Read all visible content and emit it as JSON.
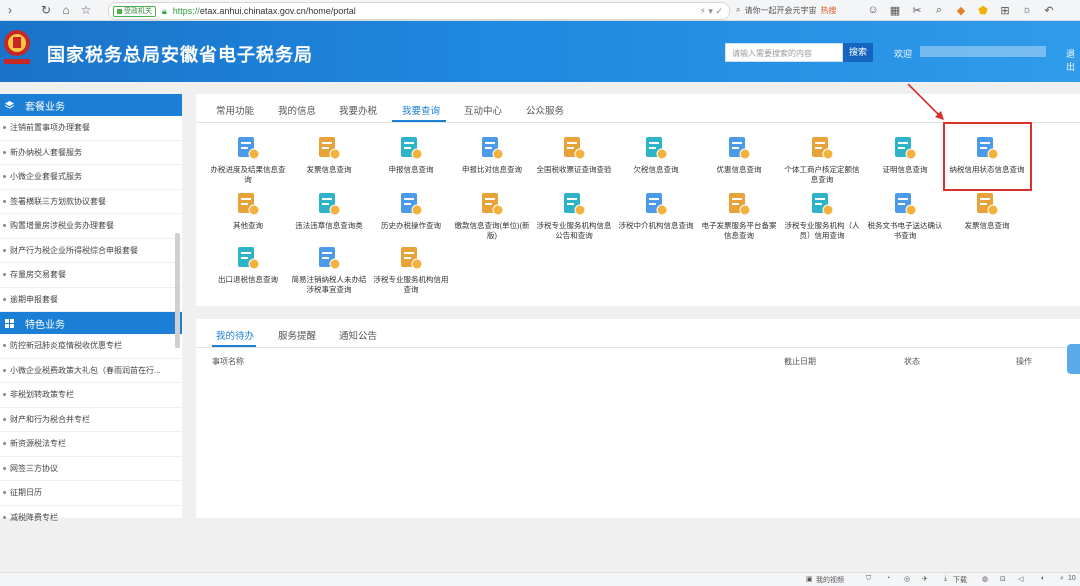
{
  "browser": {
    "security_label": "受政机关",
    "url_scheme": "https://",
    "url_rest": "etax.anhui.chinatax.gov.cn/home/portal",
    "search_placeholder": "请你一起开会元宇宙",
    "hot_label": "热搜"
  },
  "header": {
    "site_title": "国家税务总局安徽省电子税务局",
    "search_placeholder": "请输入需要搜索的内容",
    "search_button": "搜索",
    "welcome": "欢迎",
    "logout": "退出"
  },
  "sidebar": {
    "section1_title": "套餐业务",
    "section1_items": [
      "注销前置事项办理套餐",
      "新办纳税人套餐服务",
      "小微企业套餐式服务",
      "签署横联三方划款协议套餐",
      "购置增量房涉税业务办理套餐",
      "财产行为税企业所得税综合申报套餐",
      "存量房交易套餐",
      "逾期申报套餐"
    ],
    "section2_title": "特色业务",
    "section2_items": [
      "防控新冠肺炎疫情税收优惠专栏",
      "小微企业税费政策大礼包（春雨润苗在行...",
      "非税划转政策专栏",
      "财产和行为税合并专栏",
      "新资源税法专栏",
      "网签三方协议",
      "征期日历",
      "减税降费专栏"
    ]
  },
  "main": {
    "tabs": [
      "常用功能",
      "我的信息",
      "我要办税",
      "我要查询",
      "互动中心",
      "公众服务"
    ],
    "active_tab": "我要查询",
    "services": [
      {
        "label": "办税进度及结果信息查询",
        "icon": "search-doc-icon"
      },
      {
        "label": "发票信息查询",
        "icon": "invoice-icon"
      },
      {
        "label": "申报信息查询",
        "icon": "declare-icon"
      },
      {
        "label": "申报比对信息查询",
        "icon": "compare-icon"
      },
      {
        "label": "全国税收票证查询查验",
        "icon": "ticket-icon"
      },
      {
        "label": "欠税信息查询",
        "icon": "arrears-icon"
      },
      {
        "label": "优惠信息查询",
        "icon": "discount-icon"
      },
      {
        "label": "个体工商户核定定额信息查询",
        "icon": "quota-icon"
      },
      {
        "label": "证明信息查询",
        "icon": "certificate-icon"
      },
      {
        "label": "纳税信用状态信息查询",
        "icon": "credit-icon"
      },
      {
        "label": "其他查询",
        "icon": "other-search-icon"
      },
      {
        "label": "违法违章信息查询类",
        "icon": "warning-icon"
      },
      {
        "label": "历史办税操作查询",
        "icon": "history-icon"
      },
      {
        "label": "缴款信息查询(单位)(新版)",
        "icon": "payment-icon"
      },
      {
        "label": "涉税专业服务机构信息公告和查询",
        "icon": "agency-notice-icon"
      },
      {
        "label": "涉税中介机构信息查询",
        "icon": "intermediary-icon"
      },
      {
        "label": "电子发票服务平台备案信息查询",
        "icon": "e-invoice-icon"
      },
      {
        "label": "涉税专业服务机构（人员）信用查询",
        "icon": "agency-credit-icon"
      },
      {
        "label": "税务文书电子送达确认书查询",
        "icon": "document-delivery-icon"
      },
      {
        "label": "发票信息查询",
        "icon": "invoice-user-icon"
      },
      {
        "label": "出口退税信息查询",
        "icon": "export-refund-icon"
      },
      {
        "label": "简易注销纳税人未办结涉税事宜查询",
        "icon": "cancel-user-icon"
      },
      {
        "label": "涉税专业服务机构信用查询",
        "icon": "agency-building-icon"
      }
    ]
  },
  "bottom": {
    "tabs": [
      "我的待办",
      "服务提醒",
      "通知公告"
    ],
    "active_tab": "我的待办",
    "columns": [
      "事项名称",
      "截止日期",
      "状态",
      "操作"
    ]
  },
  "statusbar": {
    "video": "我的视频",
    "download": "下载",
    "zoom": "10"
  },
  "colors": {
    "brand_blue": "#1c7fd6",
    "header_blue": "#1f88df",
    "highlight_red": "#d9302c"
  }
}
